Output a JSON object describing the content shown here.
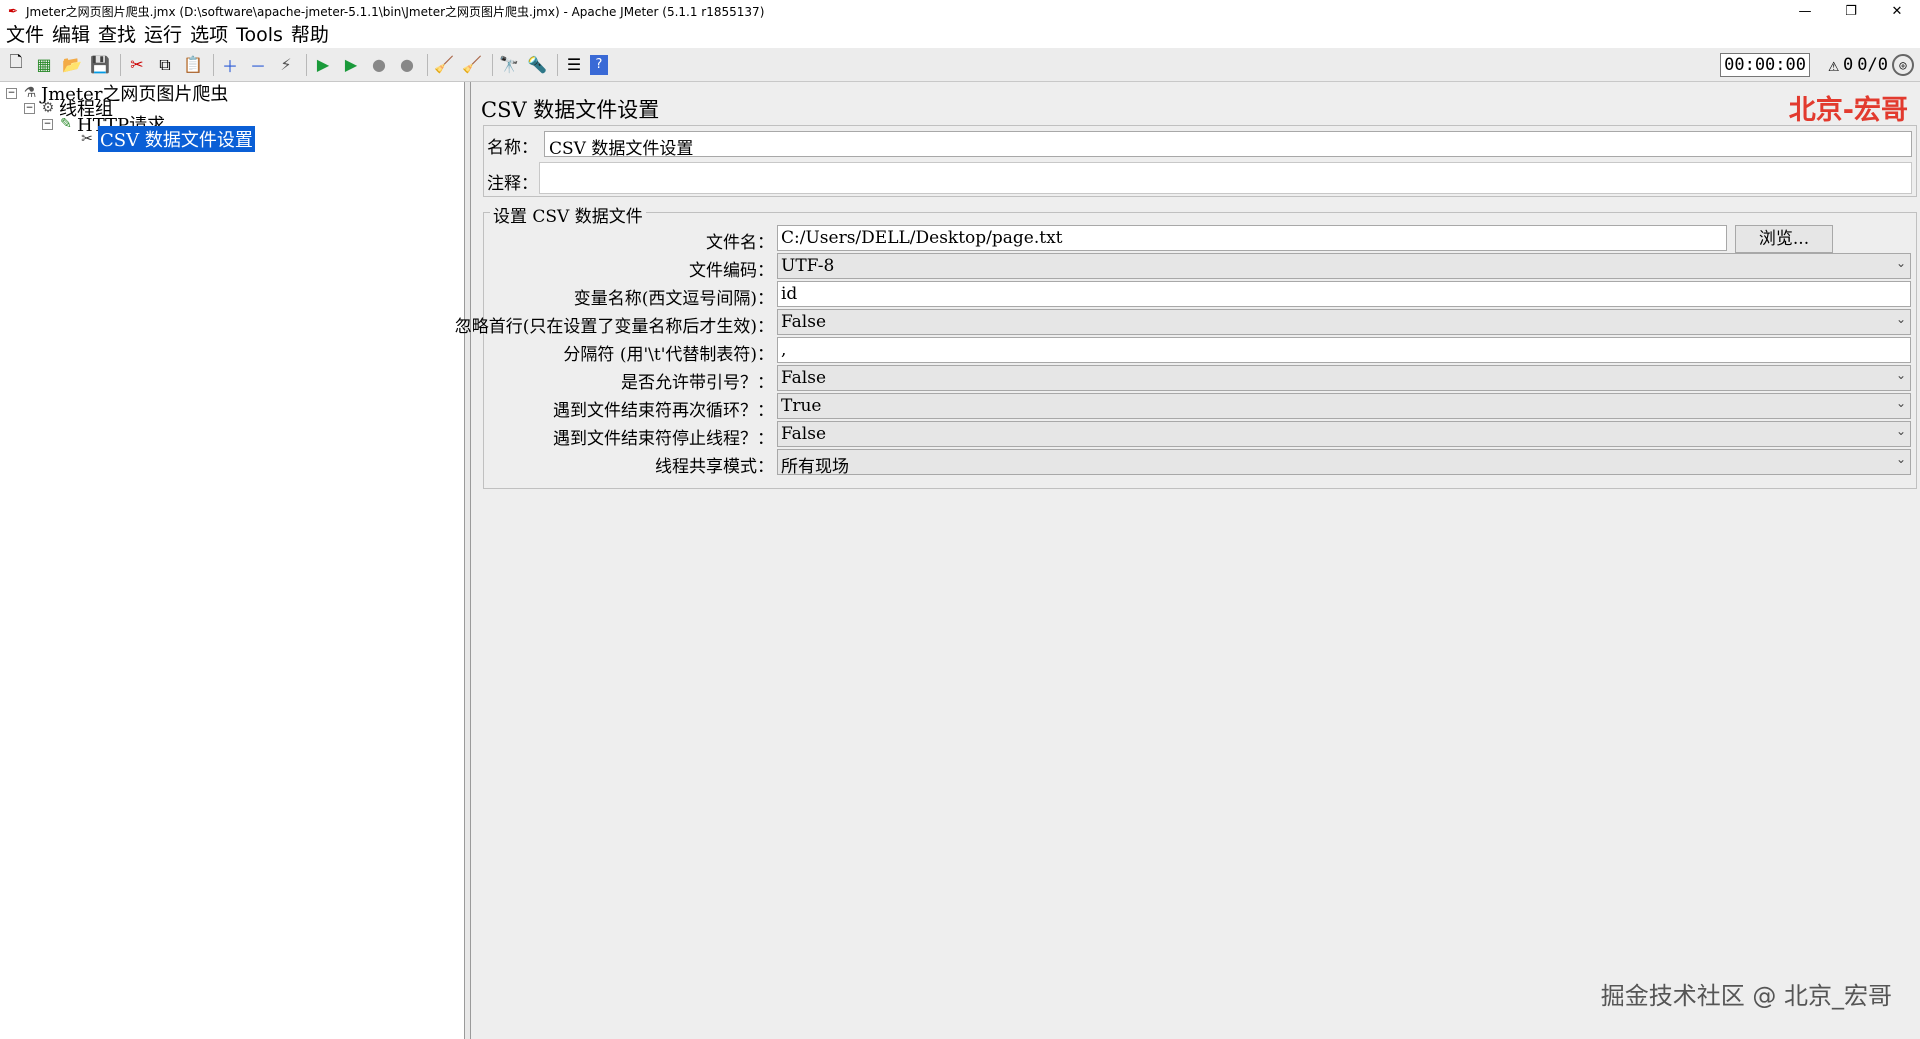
{
  "window": {
    "title": "Jmeter之网页图片爬虫.jmx (D:\\software\\apache-jmeter-5.1.1\\bin\\Jmeter之网页图片爬虫.jmx) - Apache JMeter (5.1.1 r1855137)",
    "minimize": "—",
    "restore": "❐",
    "close": "✕"
  },
  "menu": [
    "文件",
    "编辑",
    "查找",
    "运行",
    "选项",
    "Tools",
    "帮助"
  ],
  "toolbar": {
    "timer": "00:00:00",
    "warning_count": "0",
    "threads": "0/0"
  },
  "tree": {
    "root": "Jmeter之网页图片爬虫",
    "thread_group": "线程组",
    "http_request": "HTTP请求",
    "csv_config": "CSV 数据文件设置"
  },
  "panel": {
    "title": "CSV 数据文件设置",
    "brand": "北京-宏哥",
    "name_label": "名称：",
    "name_value": "CSV 数据文件设置",
    "comment_label": "注释：",
    "comment_value": "",
    "group_title": "设置 CSV 数据文件",
    "browse": "浏览...",
    "rows": {
      "filename": {
        "label": "文件名：",
        "value": "C:/Users/DELL/Desktop/page.txt"
      },
      "encoding": {
        "label": "文件编码：",
        "value": "UTF-8"
      },
      "var_names": {
        "label": "变量名称(西文逗号间隔)：",
        "value": "id"
      },
      "ignore_first": {
        "label": "忽略首行(只在设置了变量名称后才生效)：",
        "value": "False"
      },
      "delimiter": {
        "label": "分隔符 (用'\\t'代替制表符)：",
        "value": ","
      },
      "allow_quoted": {
        "label": "是否允许带引号？：",
        "value": "False"
      },
      "recycle_eof": {
        "label": "遇到文件结束符再次循环？：",
        "value": "True"
      },
      "stop_eof": {
        "label": "遇到文件结束符停止线程？：",
        "value": "False"
      },
      "sharing": {
        "label": "线程共享模式：",
        "value": "所有现场"
      }
    }
  },
  "watermark": "掘金技术社区 @ 北京_宏哥"
}
